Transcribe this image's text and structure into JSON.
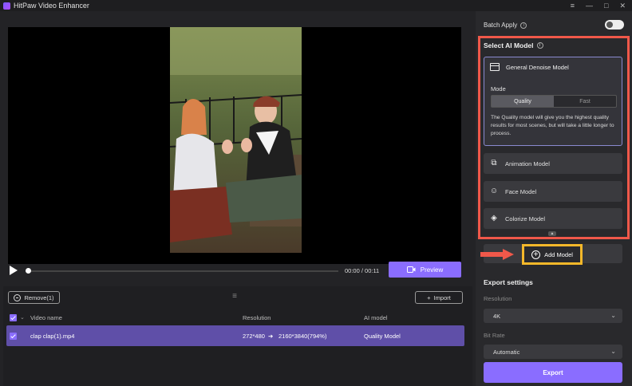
{
  "titlebar": {
    "app_title": "HitPaw Video Enhancer",
    "controls": [
      "≡",
      "—",
      "□",
      "✕"
    ]
  },
  "player": {
    "timecode": "00:00 / 00:11",
    "progress_fraction": 0.0,
    "preview_label": "Preview"
  },
  "list": {
    "remove_label": "Remove(1)",
    "import_label": "Import",
    "columns": [
      "Video name",
      "Resolution",
      "AI model"
    ],
    "rows": [
      {
        "name": "clap clap(1).mp4",
        "resolution_from": "272*480",
        "resolution_to": "2160*3840(794%)",
        "model": "Quality Model"
      }
    ]
  },
  "sidebar": {
    "batch_apply_label": "Batch Apply",
    "select_model_title": "Select AI Model",
    "active_model": {
      "name": "General Denoise Model",
      "mode_label": "Mode",
      "modes": [
        "Quality",
        "Fast"
      ],
      "selected_mode": "Quality",
      "description": "The Quality model will give you the highest quality results for most scenes, but will take a little longer to process."
    },
    "models": [
      {
        "name": "Animation Model",
        "icon": "animation-icon"
      },
      {
        "name": "Face Model",
        "icon": "face-icon"
      },
      {
        "name": "Colorize Model",
        "icon": "colorize-icon"
      }
    ],
    "add_model_label": "Add Model",
    "export_settings_title": "Export settings",
    "resolution_label": "Resolution",
    "resolution_value": "4K",
    "bitrate_label": "Bit Rate",
    "bitrate_value": "Automatic",
    "export_label": "Export"
  },
  "colors": {
    "accent": "#8a6dff",
    "highlight_red": "#f0584a",
    "highlight_yellow": "#f5b82a"
  }
}
